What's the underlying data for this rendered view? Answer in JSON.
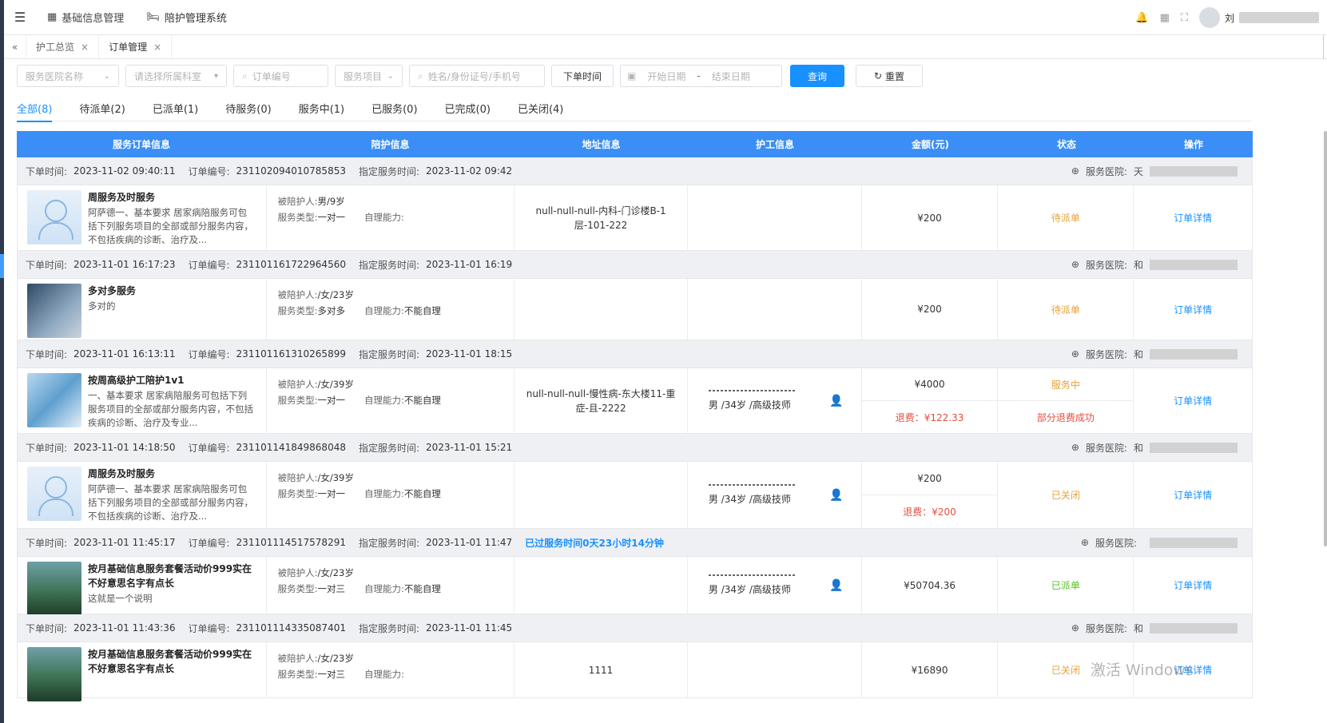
{
  "header": {
    "nav": [
      {
        "label": "基础信息管理",
        "icon": "grid-icon"
      },
      {
        "label": "陪护管理系统",
        "icon": "bed-icon"
      }
    ],
    "user_initial": "刘"
  },
  "tabs": [
    {
      "label": "护工总览"
    },
    {
      "label": "订单管理"
    }
  ],
  "filters": {
    "hospital_placeholder": "服务医院名称",
    "department_placeholder": "请选择所属科室",
    "order_no_placeholder": "订单编号",
    "service_item_placeholder": "服务项目",
    "person_placeholder": "姓名/身份证号/手机号",
    "time_type": "下单时间",
    "start_date_placeholder": "开始日期",
    "date_separator": "-",
    "end_date_placeholder": "结束日期",
    "query_label": "查询",
    "reset_label": "重置"
  },
  "status_tabs": [
    "全部(8)",
    "待派单(2)",
    "已派单(1)",
    "待服务(0)",
    "服务中(1)",
    "已服务(0)",
    "已完成(0)",
    "已关闭(4)"
  ],
  "columns": [
    "服务订单信息",
    "陪护信息",
    "地址信息",
    "护工信息",
    "金额(元)",
    "状态",
    "操作"
  ],
  "labels": {
    "order_time": "下单时间:",
    "order_no": "订单编号:",
    "service_time": "指定服务时间:",
    "hospital": "服务医院:",
    "patient": "被陪护人:",
    "service_type": "服务类型:",
    "self_care": "自理能力:",
    "detail": "订单详情"
  },
  "orders": [
    {
      "order_time": "2023-11-02 09:40:11",
      "order_no": "231102094010785853",
      "service_time": "2023-11-02 09:42",
      "overdue": "",
      "hospital_initial": "天",
      "thumb": "nurse",
      "title": "周服务及时服务",
      "desc": "阿萨德一、基本要求 居家病陪服务可包括下列服务项目的全部或部分服务内容，不包括疾病的诊断、治疗及...",
      "patient": "男/9岁",
      "service_type": "一对一",
      "self_care": "",
      "address": "null-null-null-内科-门诊楼B-1层-101-222",
      "worker": "",
      "amount": "¥200",
      "refund": "",
      "status": "待派单",
      "status2": "",
      "status_class": "st-pend"
    },
    {
      "order_time": "2023-11-01 16:17:23",
      "order_no": "231101161722964560",
      "service_time": "2023-11-01 16:19",
      "overdue": "",
      "hospital_initial": "和",
      "thumb": "people",
      "title": "多对多服务",
      "desc": "多对的",
      "patient": "/女/23岁",
      "service_type": "多对多",
      "self_care": "不能自理",
      "address": "",
      "worker": "",
      "amount": "¥200",
      "refund": "",
      "status": "待派单",
      "status2": "",
      "status_class": "st-pend"
    },
    {
      "order_time": "2023-11-01 16:13:11",
      "order_no": "231101161310265899",
      "service_time": "2023-11-01 18:15",
      "overdue": "",
      "hospital_initial": "和",
      "thumb": "medical",
      "title": "按周高级护工陪护1v1",
      "desc": "一、基本要求 居家病陪服务可包括下列服务项目的全部或部分服务内容，不包括疾病的诊断、治疗及专业...",
      "patient": "/女/39岁",
      "service_type": "一对一",
      "self_care": "不能自理",
      "address": "null-null-null-慢性病-东大楼11-重症-且-2222",
      "worker": "男 /34岁 /高级技师",
      "amount": "¥4000",
      "refund": "退费：¥122.33",
      "status": "服务中",
      "status2": "部分退费成功",
      "status_class": "st-srv"
    },
    {
      "order_time": "2023-11-01 14:18:50",
      "order_no": "231101141849868048",
      "service_time": "2023-11-01 15:21",
      "overdue": "",
      "hospital_initial": "和",
      "thumb": "nurse",
      "title": "周服务及时服务",
      "desc": "阿萨德一、基本要求 居家病陪服务可包括下列服务项目的全部或部分服务内容，不包括疾病的诊断、治疗及...",
      "patient": "/女/39岁",
      "service_type": "一对一",
      "self_care": "不能自理",
      "address": "",
      "worker": "男 /34岁 /高级技师",
      "amount": "¥200",
      "refund": "退费：¥200",
      "status": "已关闭",
      "status2": "",
      "status_class": "st-closed"
    },
    {
      "order_time": "2023-11-01 11:45:17",
      "order_no": "231101114517578291",
      "service_time": "2023-11-01 11:47",
      "overdue": "已过服务时间0天23小时14分钟",
      "hospital_initial": "",
      "thumb": "green",
      "title": "按月基础信息服务套餐活动价999实在不好意思名字有点长",
      "desc": "这就是一个说明",
      "patient": "/女/23岁",
      "service_type": "一对三",
      "self_care": "不能自理",
      "address": "",
      "worker": "男 /34岁 /高级技师",
      "amount": "¥50704.36",
      "refund": "",
      "status": "已派单",
      "status2": "",
      "status_class": "st-sent"
    },
    {
      "order_time": "2023-11-01 11:43:36",
      "order_no": "231101114335087401",
      "service_time": "2023-11-01 11:45",
      "overdue": "",
      "hospital_initial": "和",
      "thumb": "green",
      "title": "按月基础信息服务套餐活动价999实在不好意思名字有点长",
      "desc": "",
      "patient": "/女/23岁",
      "service_type": "一对三",
      "self_care": "",
      "address": "1111",
      "worker": "",
      "amount": "¥16890",
      "refund": "",
      "status": "已关闭",
      "status2": "",
      "status_class": "st-closed"
    }
  ],
  "watermark": "激活 Windows"
}
